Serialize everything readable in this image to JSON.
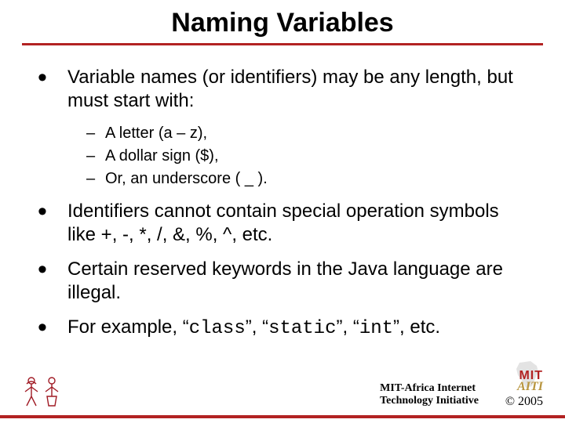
{
  "title": "Naming Variables",
  "bullets": {
    "b1": "Variable names (or identifiers) may be any length, but must start with:",
    "b1_sub": {
      "s1": "A letter (a – z),",
      "s2": "A dollar sign ($),",
      "s3": "Or, an underscore ( _ )."
    },
    "b2": "Identifiers cannot contain special operation symbols like +, -, *, /, &, %, ^, etc.",
    "b3": "Certain reserved keywords in the Java language are illegal.",
    "b4_pre": "For example, ",
    "b4_q1": "“",
    "b4_c1": "class",
    "b4_m1": "”, “",
    "b4_c2": "static",
    "b4_m2": "”, “",
    "b4_c3": "int",
    "b4_post": "”, etc."
  },
  "footer": {
    "org_line": "MIT-Africa Internet\nTechnology Initiative",
    "mit": "MIT",
    "aiti": "AITI",
    "copyright": "© 2005"
  }
}
